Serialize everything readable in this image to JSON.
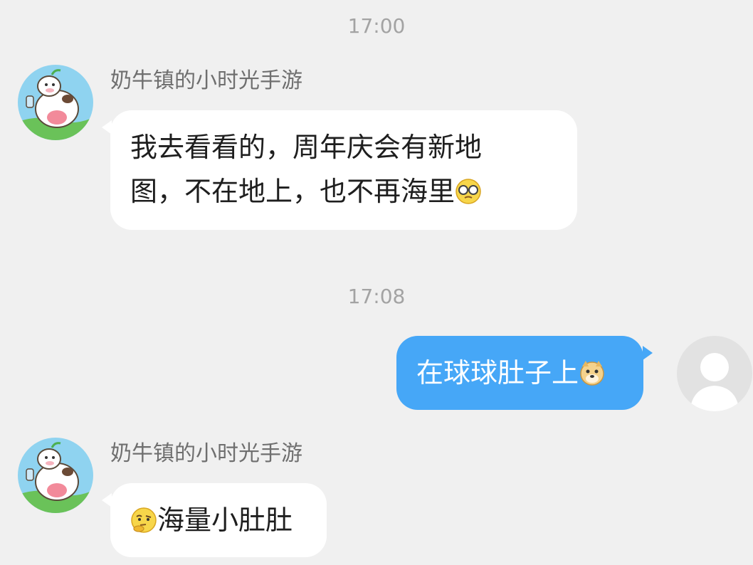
{
  "conversation": {
    "timestamps": [
      "17:00",
      "17:08"
    ],
    "messages": [
      {
        "direction": "incoming",
        "sender": "奶牛镇的小时光手游",
        "avatar": "cow-avatar",
        "lines": [
          "我去看看的，周年庆会有新地",
          "图，不在地上，也不再海里"
        ],
        "emoji": "glasses-face-emoji"
      },
      {
        "direction": "outgoing",
        "avatar": "default-user-avatar",
        "text": "在球球肚子上",
        "emoji": "doge-emoji"
      },
      {
        "direction": "incoming",
        "sender": "奶牛镇的小时光手游",
        "avatar": "cow-avatar",
        "leading_emoji": "thinking-face-emoji",
        "text": "海量小肚肚"
      }
    ]
  },
  "colors": {
    "background": "#f0f0f0",
    "incoming_bubble": "#ffffff",
    "outgoing_bubble": "#46a7f7",
    "timestamp_text": "#a3a3a3",
    "sender_text": "#6f6f6f"
  }
}
